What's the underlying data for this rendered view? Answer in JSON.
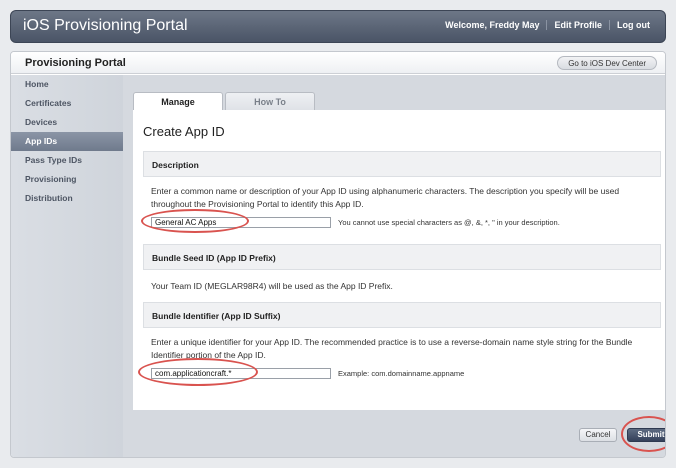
{
  "header": {
    "title": "iOS Provisioning Portal",
    "welcome": "Welcome, Freddy May",
    "edit_profile": "Edit Profile",
    "logout": "Log out"
  },
  "panel": {
    "title": "Provisioning Portal",
    "dev_center_button": "Go to iOS Dev Center"
  },
  "sidebar": {
    "items": [
      {
        "label": "Home"
      },
      {
        "label": "Certificates"
      },
      {
        "label": "Devices"
      },
      {
        "label": "App IDs"
      },
      {
        "label": "Pass Type IDs"
      },
      {
        "label": "Provisioning"
      },
      {
        "label": "Distribution"
      }
    ],
    "active_index": 3
  },
  "tabs": [
    {
      "label": "Manage",
      "active": true
    },
    {
      "label": "How To",
      "active": false
    }
  ],
  "form": {
    "heading": "Create App ID",
    "description": {
      "header": "Description",
      "text": "Enter a common name or description of your App ID using alphanumeric characters. The description you specify will be used throughout the Provisioning Portal to identify this App ID.",
      "value": "General AC Apps",
      "hint": "You cannot use special characters as @, &, *, \" in your description."
    },
    "bundle_seed": {
      "header": "Bundle Seed ID (App ID Prefix)",
      "text": "Your Team ID (MEGLAR98R4) will be used as the App ID Prefix."
    },
    "bundle_identifier": {
      "header": "Bundle Identifier (App ID Suffix)",
      "text": "Enter a unique identifier for your App ID. The recommended practice is to use a reverse-domain name style string for the Bundle Identifier portion of the App ID.",
      "value": "com.applicationcraft.*",
      "hint": "Example: com.domainname.appname"
    }
  },
  "buttons": {
    "cancel": "Cancel",
    "submit": "Submit"
  },
  "colors": {
    "highlight_oval": "#d9534f",
    "active_nav": "#7b8698",
    "submit_button": "#3b4760"
  }
}
